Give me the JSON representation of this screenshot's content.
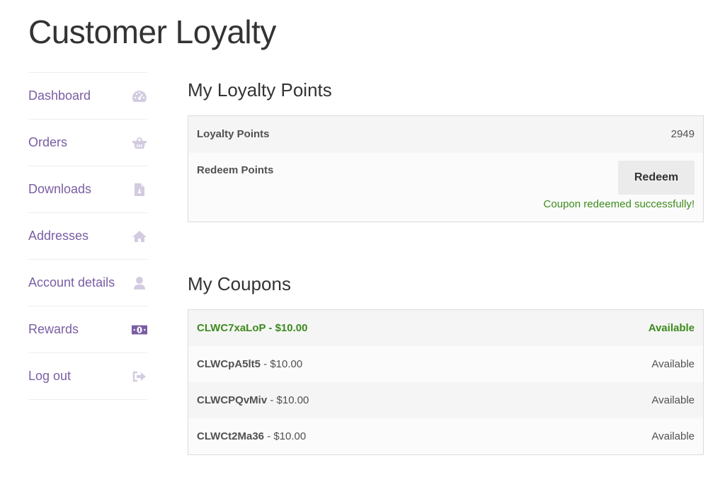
{
  "page": {
    "title": "Customer Loyalty"
  },
  "sidebar": {
    "items": [
      {
        "label": "Dashboard",
        "icon": "dashboard-gauge-icon"
      },
      {
        "label": "Orders",
        "icon": "basket-icon"
      },
      {
        "label": "Downloads",
        "icon": "file-download-icon"
      },
      {
        "label": "Addresses",
        "icon": "home-icon"
      },
      {
        "label": "Account details",
        "icon": "user-icon"
      },
      {
        "label": "Rewards",
        "icon": "money-icon"
      },
      {
        "label": "Log out",
        "icon": "logout-icon"
      }
    ]
  },
  "loyalty": {
    "title": "My Loyalty Points",
    "points_label": "Loyalty Points",
    "points_value": "2949",
    "redeem_label": "Redeem Points",
    "redeem_button": "Redeem",
    "success_message": "Coupon redeemed successfully!"
  },
  "coupons": {
    "title": "My Coupons",
    "items": [
      {
        "code": "CLWC7xaLoP",
        "amount": " - $10.00",
        "status": "Available"
      },
      {
        "code": "CLWCpA5lt5",
        "amount": " - $10.00",
        "status": "Available"
      },
      {
        "code": "CLWCPQvMiv",
        "amount": " - $10.00",
        "status": "Available"
      },
      {
        "code": "CLWCt2Ma36",
        "amount": " - $10.00",
        "status": "Available"
      }
    ]
  },
  "colors": {
    "accent": "#7a5ea3",
    "icon_muted": "#d3cbe0",
    "success": "#3d8b1e"
  }
}
